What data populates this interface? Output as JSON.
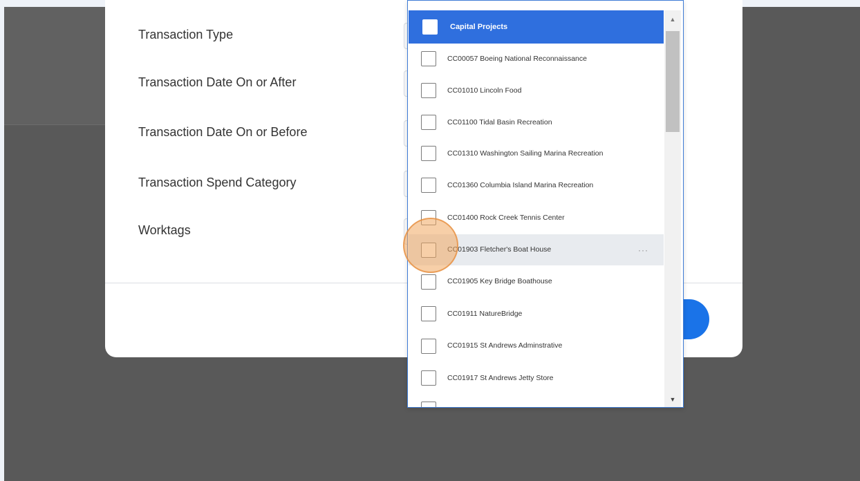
{
  "form": {
    "fields": [
      {
        "label": "Transaction Type"
      },
      {
        "label": "Transaction Date On or After"
      },
      {
        "label": "Transaction Date On or Before"
      },
      {
        "label": "Transaction Spend Category"
      },
      {
        "label": "Worktags"
      }
    ]
  },
  "dropdown": {
    "header": "Capital Projects",
    "items": [
      {
        "label": "CC00057 Boeing National Reconnaissance"
      },
      {
        "label": "CC01010 Lincoln Food"
      },
      {
        "label": "CC01100 Tidal Basin Recreation"
      },
      {
        "label": "CC01310 Washington Sailing Marina Recreation"
      },
      {
        "label": "CC01360 Columbia Island Marina Recreation"
      },
      {
        "label": "CC01400 Rock Creek Tennis Center"
      },
      {
        "label": "CC01903 Fletcher's Boat House",
        "more": "···"
      },
      {
        "label": "CC01905 Key Bridge Boathouse"
      },
      {
        "label": "CC01911 NatureBridge"
      },
      {
        "label": "CC01915 St Andrews Adminstrative"
      },
      {
        "label": "CC01917 St Andrews Jetty Store"
      }
    ],
    "scroll_up_glyph": "▲",
    "scroll_down_glyph": "▼"
  },
  "colors": {
    "accent": "#2f6fde",
    "primary_button": "#1a73e8",
    "backdrop": "#595959",
    "click_highlight": "#f0a860"
  }
}
